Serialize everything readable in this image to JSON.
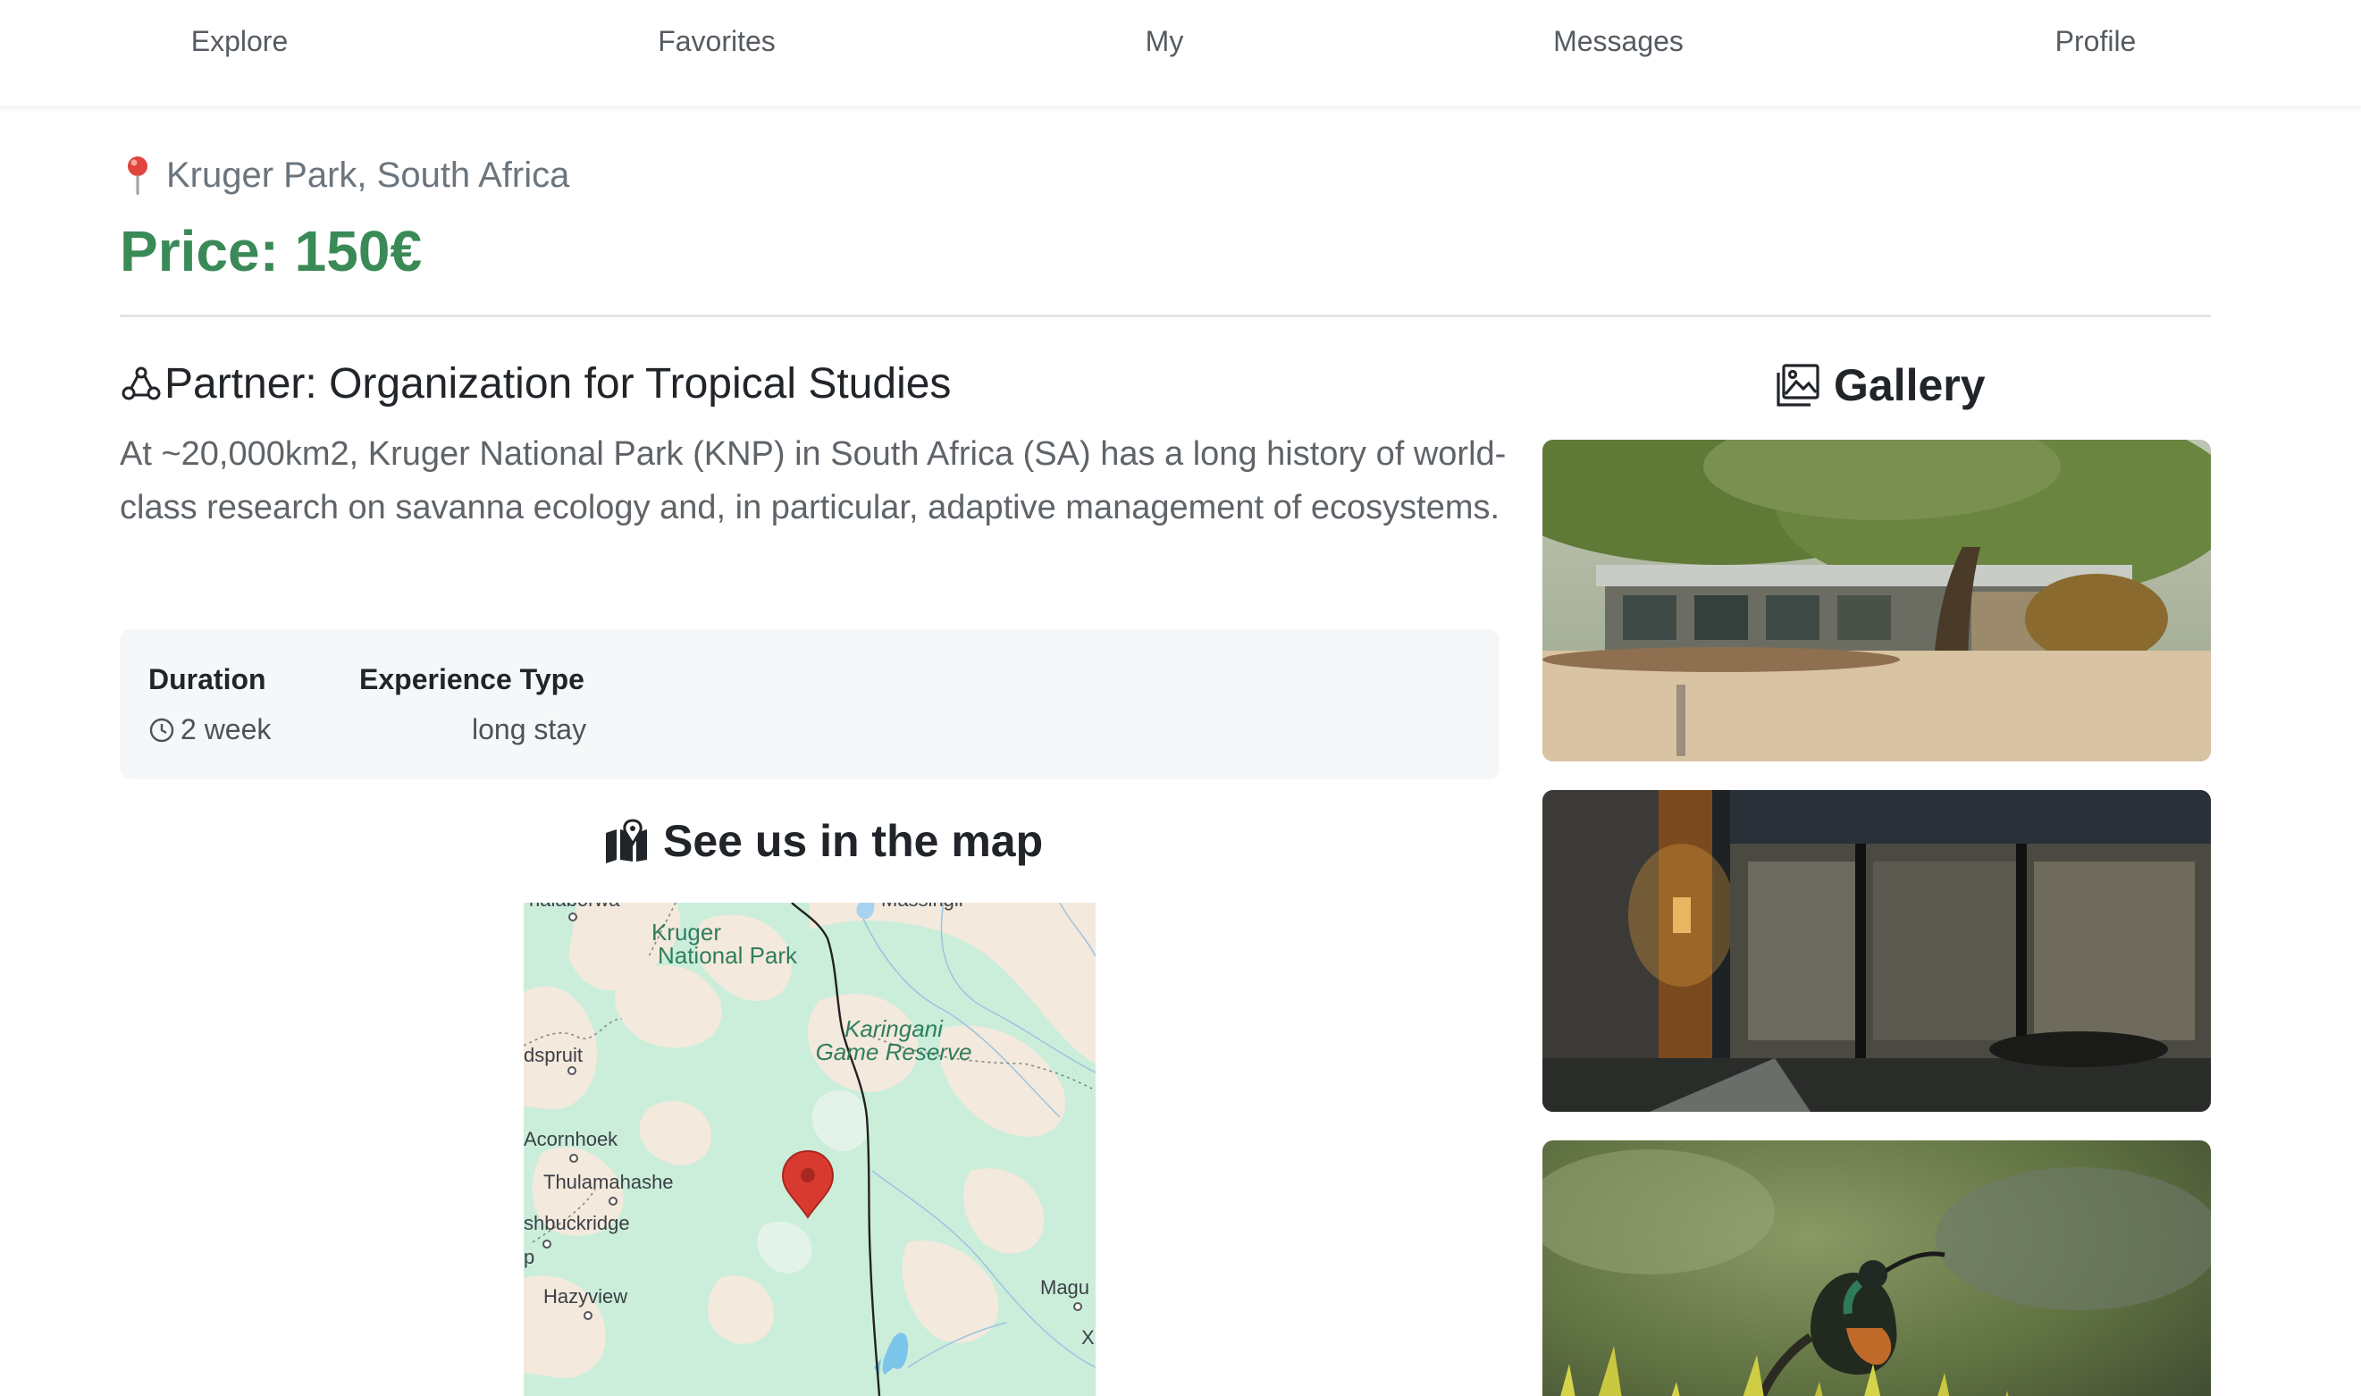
{
  "nav": {
    "items": [
      "Explore",
      "Favorites",
      "My",
      "Messages",
      "Profile"
    ]
  },
  "listing": {
    "location": "Kruger Park, South Africa",
    "price": "Price: 150€",
    "partner": "Partner: Organization for Tropical Studies",
    "description": "At ~20,000km2, Kruger National Park (KNP) in South Africa (SA) has a long history of world-class research on savanna ecology and, in particular, adaptive management of ecosystems."
  },
  "details": {
    "duration_label": "Duration",
    "duration_value": "2 week",
    "experience_label": "Experience Type",
    "experience_value": "long stay"
  },
  "map": {
    "title": "See us in the map",
    "labels": {
      "phalaborwa": "halaborwa",
      "massingir": "Massingir",
      "kruger_1": "Kruger",
      "kruger_2": "National Park",
      "karingani_1": "Karingani",
      "karingani_2": "Game Reserve",
      "hoedspruit": "dspruit",
      "acornhoek": "Acornhoek",
      "thulamahashe": "Thulamahashe",
      "bushbuckridge": "shbuckridge",
      "p": "p",
      "hazyview": "Hazyview",
      "magude": "Magu",
      "x": "X"
    }
  },
  "gallery": {
    "title": "Gallery"
  },
  "colors": {
    "price": "#3a8a57",
    "pin": "#d93a2f",
    "map_land": "#cbeedb",
    "map_sand": "#f3e9dc"
  }
}
